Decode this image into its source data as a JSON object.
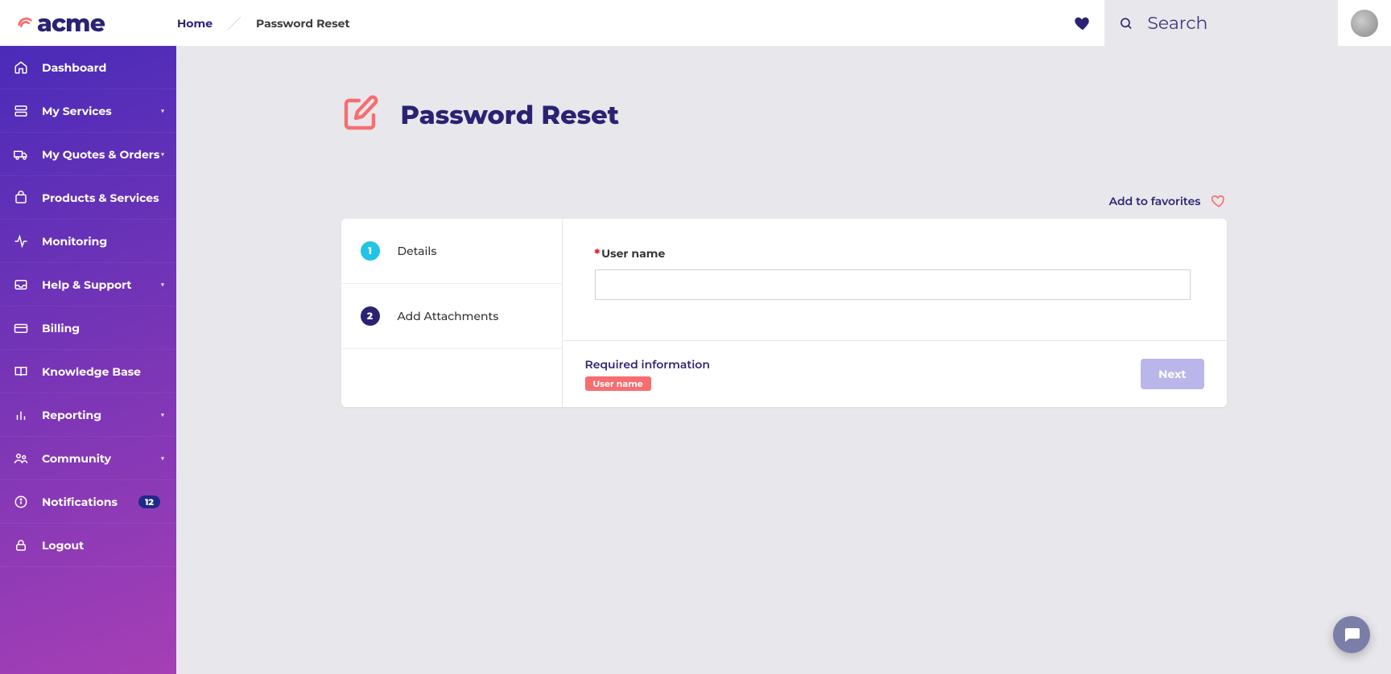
{
  "brand": {
    "name": "acme"
  },
  "breadcrumbs": {
    "home": "Home",
    "current": "Password Reset"
  },
  "search": {
    "placeholder": "Search"
  },
  "sidebar": {
    "items": [
      {
        "label": "Dashboard",
        "expandable": false
      },
      {
        "label": "My Services",
        "expandable": true
      },
      {
        "label": "My Quotes & Orders",
        "expandable": true
      },
      {
        "label": "Products & Services",
        "expandable": false
      },
      {
        "label": "Monitoring",
        "expandable": false
      },
      {
        "label": "Help & Support",
        "expandable": true
      },
      {
        "label": "Billing",
        "expandable": false
      },
      {
        "label": "Knowledge Base",
        "expandable": false
      },
      {
        "label": "Reporting",
        "expandable": true
      },
      {
        "label": "Community",
        "expandable": true
      },
      {
        "label": "Notifications",
        "expandable": false,
        "badge": "12"
      },
      {
        "label": "Logout",
        "expandable": false
      }
    ]
  },
  "page": {
    "title": "Password Reset",
    "add_favorites": "Add to favorites"
  },
  "steps": [
    {
      "num": "1",
      "label": "Details"
    },
    {
      "num": "2",
      "label": "Add Attachments"
    }
  ],
  "form": {
    "username_label": "User name",
    "username_value": "",
    "required_heading": "Required information",
    "required_field_pill": "User name",
    "next_label": "Next"
  }
}
